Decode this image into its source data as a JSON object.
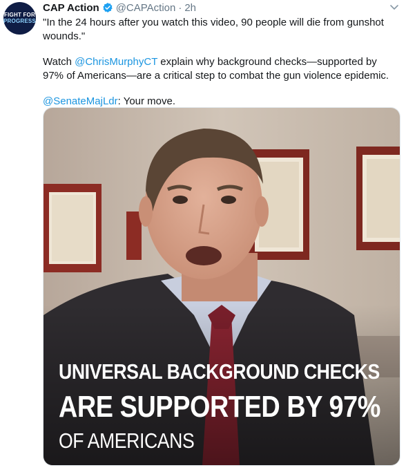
{
  "account": {
    "avatar_line1": "FIGHT FOR",
    "avatar_line2": "PROGRESS",
    "display_name": "CAP Action",
    "handle": "@CAPAction",
    "separator": "·",
    "time": "2h",
    "verified_color": "#1da1f2"
  },
  "tweet": {
    "line1": "\"In the 24 hours after you watch this video, 90 people will die from gunshot wounds.\"",
    "para2_before": "Watch ",
    "para2_mention": "@ChrisMurphyCT",
    "para2_after": " explain why background checks—supported by 97% of Americans—are a critical step to combat the gun violence epidemic.",
    "para3_mention": "@SenateMajLdr",
    "para3_after": ": Your move.",
    "mention_color": "#1b95e0"
  },
  "media": {
    "type": "video",
    "caption_line1": "UNIVERSAL BACKGROUND CHECKS",
    "caption_line2": "ARE SUPPORTED BY 97%",
    "caption_line3": "OF AMERICANS"
  }
}
